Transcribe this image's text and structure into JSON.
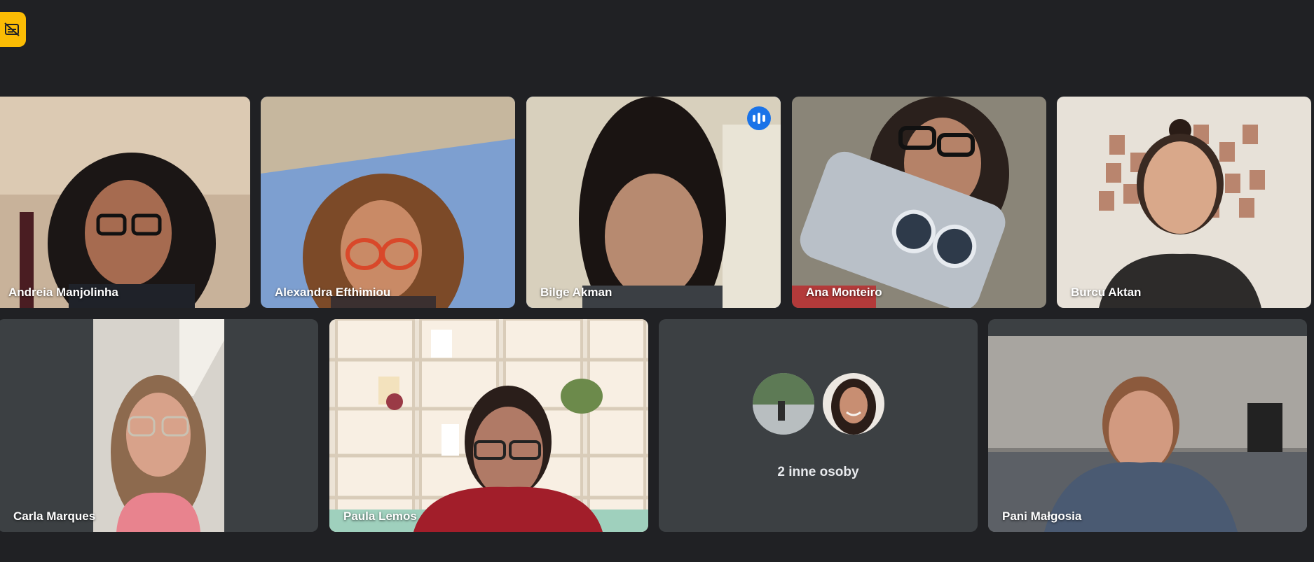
{
  "toolbar": {
    "caption_icon": "captions-off-icon"
  },
  "participants": [
    {
      "name": "Andreia Manjolinha"
    },
    {
      "name": "Alexandra Efthimiou"
    },
    {
      "name": "Bilge Akman",
      "speaking": true
    },
    {
      "name": "Ana Monteiro"
    },
    {
      "name": "Burcu Aktan"
    },
    {
      "name": "Carla Marques"
    },
    {
      "name": "Paula Lemos"
    },
    {
      "name": "Pani Małgosia"
    }
  ],
  "others": {
    "label": "2 inne osoby",
    "count": 2
  },
  "colors": {
    "background": "#202124",
    "tile": "#3c4043",
    "accent": "#8ab4f8",
    "badge": "#1a73e8",
    "caption_btn": "#fbbc04"
  }
}
